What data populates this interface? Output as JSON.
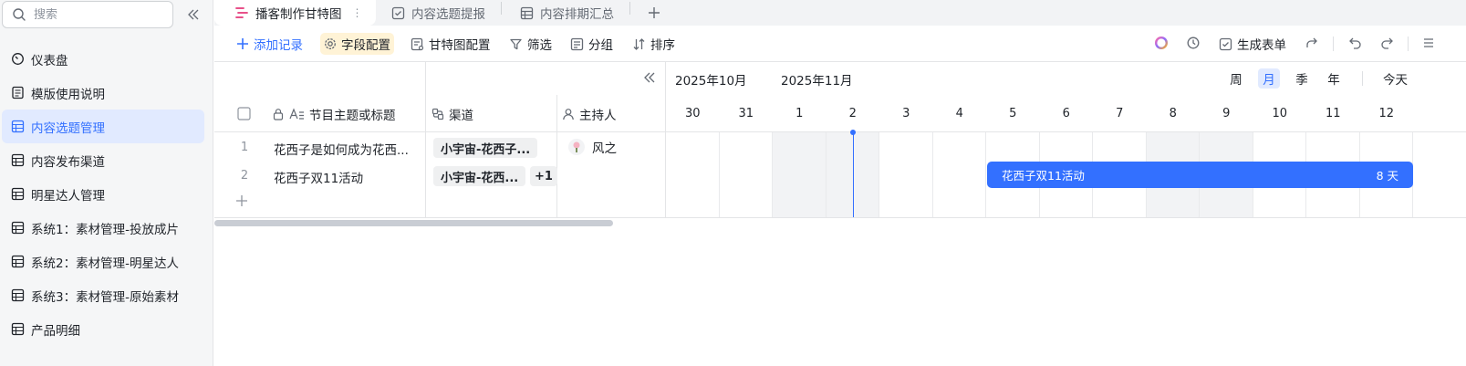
{
  "sidebar": {
    "search_placeholder": "搜索",
    "items": [
      {
        "label": "仪表盘",
        "icon": "dashboard-icon"
      },
      {
        "label": "模版使用说明",
        "icon": "doc-icon"
      },
      {
        "label": "内容选题管理",
        "icon": "table-icon",
        "active": true
      },
      {
        "label": "内容发布渠道",
        "icon": "table-icon"
      },
      {
        "label": "明星达人管理",
        "icon": "table-icon"
      },
      {
        "label": "系统1：素材管理-投放成片",
        "icon": "table-icon"
      },
      {
        "label": "系统2：素材管理-明星达人",
        "icon": "table-icon"
      },
      {
        "label": "系统3：素材管理-原始素材",
        "icon": "table-icon"
      },
      {
        "label": "产品明细",
        "icon": "table-icon"
      }
    ]
  },
  "tabs": [
    {
      "label": "播客制作甘特图",
      "icon": "gantt-icon",
      "active": true
    },
    {
      "label": "内容选题提报",
      "icon": "form-icon"
    },
    {
      "label": "内容排期汇总",
      "icon": "grid-icon"
    }
  ],
  "toolbar": {
    "add_record": "添加记录",
    "field_config": "字段配置",
    "gantt_config": "甘特图配置",
    "filter": "筛选",
    "group": "分组",
    "sort": "排序",
    "generate_form": "生成表单"
  },
  "table": {
    "columns": {
      "title": "节目主题或标题",
      "channel": "渠道",
      "host": "主持人"
    },
    "rows": [
      {
        "num": "1",
        "title": "花西子是如何成为花西...",
        "channel": "小宇宙-花西子...",
        "channel_extra": "",
        "host": "风之"
      },
      {
        "num": "2",
        "title": "花西子双11活动",
        "channel": "小宇宙-花西...",
        "channel_extra": "+1",
        "host": ""
      }
    ]
  },
  "gantt": {
    "months": [
      "2025年10月",
      "2025年11月"
    ],
    "scales": [
      {
        "label": "周",
        "active": false
      },
      {
        "label": "月",
        "active": true
      },
      {
        "label": "季",
        "active": false
      },
      {
        "label": "年",
        "active": false
      }
    ],
    "today_label": "今天",
    "days": [
      "30",
      "31",
      "1",
      "2",
      "3",
      "4",
      "5",
      "6",
      "7",
      "8",
      "9",
      "10",
      "11",
      "12"
    ],
    "weekend_days": [
      "1",
      "2",
      "8",
      "9"
    ],
    "today": "2",
    "bars": [
      {
        "row": 2,
        "label": "花西子双11活动",
        "duration": "8 天",
        "start": "5",
        "end": "12"
      }
    ],
    "accent_color": "#3370ff"
  }
}
